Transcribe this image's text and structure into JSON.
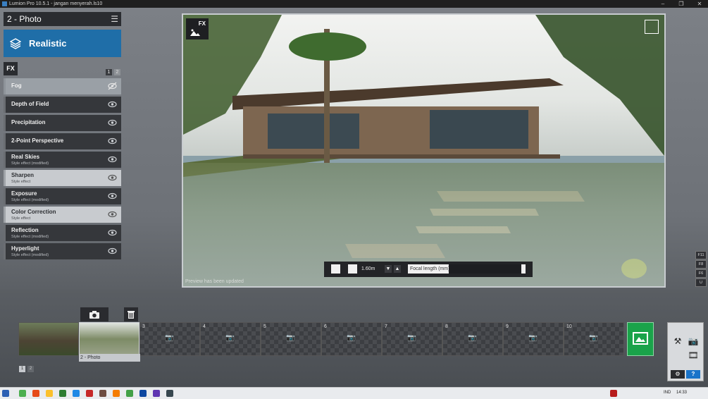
{
  "window": {
    "title": "Lumion Pro 10.5.1 - jangan menyerah.ls10"
  },
  "left_panel": {
    "mode_title": "2 - Photo",
    "style_label": "Realistic",
    "fx_tab": "FX",
    "pages": [
      "1",
      "2"
    ],
    "effects": [
      {
        "name": "Fog",
        "sub": ""
      },
      {
        "name": "Depth of Field",
        "sub": ""
      },
      {
        "name": "Precipitation",
        "sub": ""
      },
      {
        "name": "2-Point Perspective",
        "sub": ""
      },
      {
        "name": "Real Skies",
        "sub": "Style effect (modified)"
      },
      {
        "name": "Sharpen",
        "sub": "Style effect"
      },
      {
        "name": "Exposure",
        "sub": "Style effect (modified)"
      },
      {
        "name": "Color Correction",
        "sub": "Style effect"
      },
      {
        "name": "Reflection",
        "sub": "Style effect (modified)"
      },
      {
        "name": "Hyperlight",
        "sub": "Style effect (modified)"
      }
    ]
  },
  "viewport": {
    "fx_button": "FX",
    "status": "Preview has been updated",
    "camera_height": "1.60m",
    "focal_label": "Focal length (mm)"
  },
  "key_hints": [
    "F11",
    "F8",
    "F6",
    "U"
  ],
  "photo_set": {
    "slots": [
      "",
      "",
      "3",
      "4",
      "5",
      "6",
      "7",
      "8",
      "9",
      "10"
    ],
    "selected_label": "2 - Photo",
    "pages": [
      "1",
      "2"
    ]
  },
  "icons": {
    "camera": "camera-icon",
    "trash": "trash-icon",
    "render": "render-photo-icon",
    "eye": "eye-icon",
    "eye_off": "eye-off-icon"
  },
  "colors": {
    "accent": "#1f6ea8",
    "render": "#1aa34a",
    "help": "#1a73c9"
  },
  "taskbar": {
    "lang": "IND",
    "time": "14:33"
  }
}
